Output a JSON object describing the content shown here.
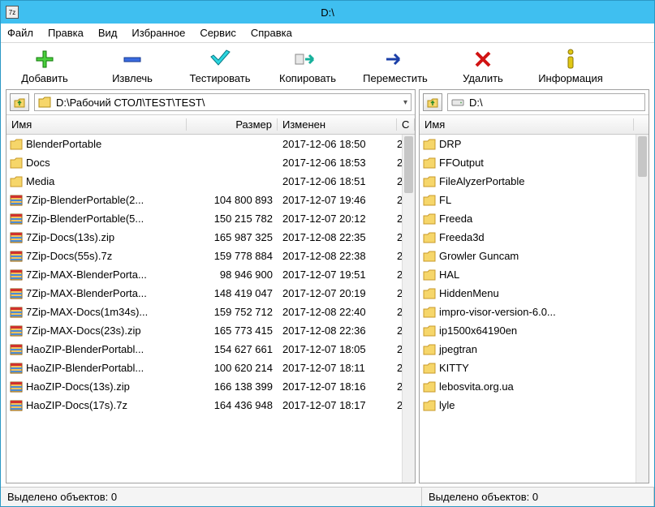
{
  "titlebar": {
    "title": "D:\\"
  },
  "menu": {
    "items": [
      "Файл",
      "Правка",
      "Вид",
      "Избранное",
      "Сервис",
      "Справка"
    ]
  },
  "toolbar": {
    "items": [
      {
        "key": "add",
        "label": "Добавить"
      },
      {
        "key": "extract",
        "label": "Извлечь"
      },
      {
        "key": "test",
        "label": "Тестировать"
      },
      {
        "key": "copy",
        "label": "Копировать"
      },
      {
        "key": "move",
        "label": "Переместить"
      },
      {
        "key": "delete",
        "label": "Удалить"
      },
      {
        "key": "info",
        "label": "Информация"
      }
    ]
  },
  "left": {
    "path": "D:\\Рабочий СТОЛ\\TEST\\TEST\\",
    "columns": {
      "name": "Имя",
      "size": "Размер",
      "modified": "Изменен",
      "cut": "С"
    },
    "rows": [
      {
        "icon": "folder",
        "name": "BlenderPortable",
        "size": "",
        "modified": "2017-12-06 18:50",
        "cut": "2"
      },
      {
        "icon": "folder",
        "name": "Docs",
        "size": "",
        "modified": "2017-12-06 18:53",
        "cut": "2"
      },
      {
        "icon": "folder",
        "name": "Media",
        "size": "",
        "modified": "2017-12-06 18:51",
        "cut": "2"
      },
      {
        "icon": "archive",
        "name": "7Zip-BlenderPortable(2...",
        "size": "104 800 893",
        "modified": "2017-12-07 19:46",
        "cut": "2"
      },
      {
        "icon": "archive",
        "name": "7Zip-BlenderPortable(5...",
        "size": "150 215 782",
        "modified": "2017-12-07 20:12",
        "cut": "2"
      },
      {
        "icon": "archive",
        "name": "7Zip-Docs(13s).zip",
        "size": "165 987 325",
        "modified": "2017-12-08 22:35",
        "cut": "2"
      },
      {
        "icon": "archive",
        "name": "7Zip-Docs(55s).7z",
        "size": "159 778 884",
        "modified": "2017-12-08 22:38",
        "cut": "2"
      },
      {
        "icon": "archive",
        "name": "7Zip-MAX-BlenderPorta...",
        "size": "98 946 900",
        "modified": "2017-12-07 19:51",
        "cut": "2"
      },
      {
        "icon": "archive",
        "name": "7Zip-MAX-BlenderPorta...",
        "size": "148 419 047",
        "modified": "2017-12-07 20:19",
        "cut": "2"
      },
      {
        "icon": "archive",
        "name": "7Zip-MAX-Docs(1m34s)...",
        "size": "159 752 712",
        "modified": "2017-12-08 22:40",
        "cut": "2"
      },
      {
        "icon": "archive",
        "name": "7Zip-MAX-Docs(23s).zip",
        "size": "165 773 415",
        "modified": "2017-12-08 22:36",
        "cut": "2"
      },
      {
        "icon": "archive",
        "name": "HaoZIP-BlenderPortabl...",
        "size": "154 627 661",
        "modified": "2017-12-07 18:05",
        "cut": "2"
      },
      {
        "icon": "archive",
        "name": "HaoZIP-BlenderPortabl...",
        "size": "100 620 214",
        "modified": "2017-12-07 18:11",
        "cut": "2"
      },
      {
        "icon": "archive",
        "name": "HaoZIP-Docs(13s).zip",
        "size": "166 138 399",
        "modified": "2017-12-07 18:16",
        "cut": "2"
      },
      {
        "icon": "archive",
        "name": "HaoZIP-Docs(17s).7z",
        "size": "164 436 948",
        "modified": "2017-12-07 18:17",
        "cut": "2"
      }
    ]
  },
  "right": {
    "path": "D:\\",
    "columns": {
      "name": "Имя",
      "cut": ""
    },
    "rows": [
      {
        "icon": "folder",
        "name": "DRP"
      },
      {
        "icon": "folder",
        "name": "FFOutput"
      },
      {
        "icon": "folder",
        "name": "FileAlyzerPortable"
      },
      {
        "icon": "folder",
        "name": "FL"
      },
      {
        "icon": "folder",
        "name": "Freeda"
      },
      {
        "icon": "folder",
        "name": "Freeda3d"
      },
      {
        "icon": "folder",
        "name": "Growler Guncam"
      },
      {
        "icon": "folder",
        "name": "HAL"
      },
      {
        "icon": "folder",
        "name": "HiddenMenu"
      },
      {
        "icon": "folder",
        "name": "impro-visor-version-6.0..."
      },
      {
        "icon": "folder",
        "name": "ip1500x64190en"
      },
      {
        "icon": "folder",
        "name": "jpegtran"
      },
      {
        "icon": "folder",
        "name": "KITTY"
      },
      {
        "icon": "folder",
        "name": "lebosvita.org.ua"
      },
      {
        "icon": "folder",
        "name": "lyle"
      }
    ]
  },
  "status": {
    "left": "Выделено объектов: 0",
    "right": "Выделено объектов: 0"
  }
}
